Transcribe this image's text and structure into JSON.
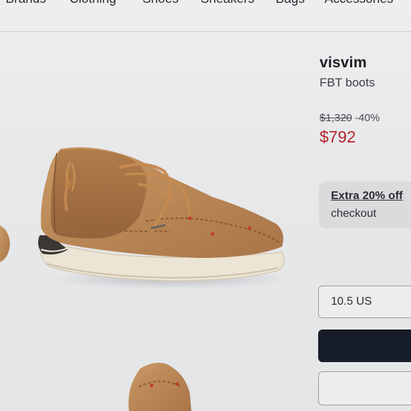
{
  "nav": {
    "items": [
      "Brands",
      "Clothing",
      "Shoes",
      "Sneakers",
      "Bags",
      "Accessories"
    ]
  },
  "product": {
    "brand": "visvim",
    "name": "FBT boots",
    "original_price": "$1,320",
    "discount": "-40%",
    "sale_price": "$792"
  },
  "promo": {
    "title": "Extra 20% off",
    "subtitle": "checkout"
  },
  "size_selector": {
    "selected": "10.5 US"
  },
  "colors": {
    "sale_price": "#b5232f",
    "primary_button": "#161c28"
  }
}
